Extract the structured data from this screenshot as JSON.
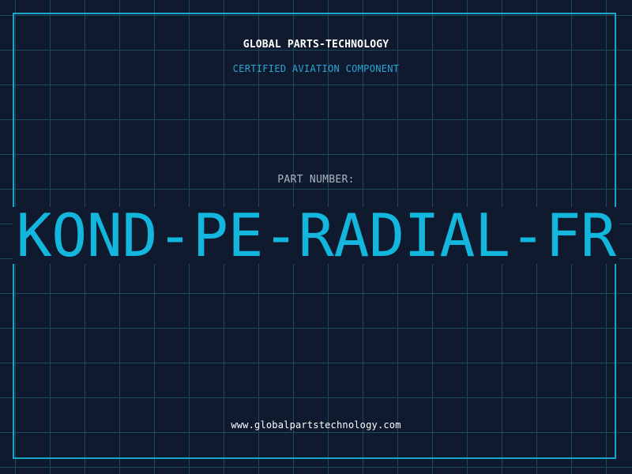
{
  "header": {
    "company": "GLOBAL PARTS-TECHNOLOGY",
    "tagline": "CERTIFIED AVIATION COMPONENT"
  },
  "part": {
    "label": "PART NUMBER:",
    "number": "KOND-PE-RADIAL-FR"
  },
  "footer": {
    "website": "www.globalpartstechnology.com"
  },
  "colors": {
    "background": "#0f1a2e",
    "grid": "#1b4a5c",
    "frame": "#1aa6c9",
    "accent": "#13b6dc",
    "tagline": "#29a5d6",
    "label": "#a9b4c2",
    "text": "#ffffff"
  }
}
